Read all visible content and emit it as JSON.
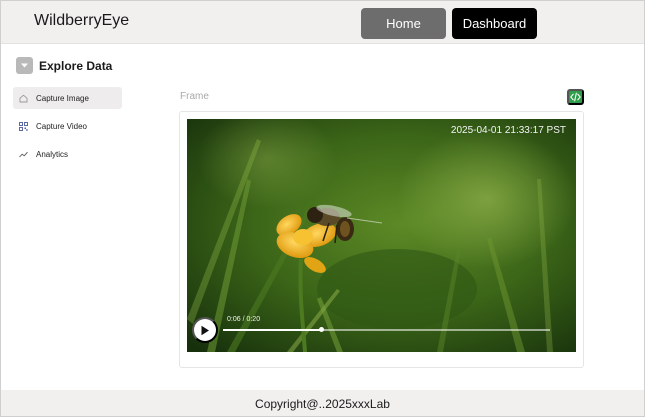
{
  "header": {
    "brand": "WildberryEye",
    "nav": {
      "home_label": "Home",
      "dashboard_label": "Dashboard"
    }
  },
  "sidebar": {
    "section_title": "Explore Data",
    "section_icon": "chevron-down-icon",
    "items": [
      {
        "label": "Capture Image",
        "icon": "camera-icon",
        "active": true
      },
      {
        "label": "Capture Video",
        "icon": "grid-icon",
        "active": false
      },
      {
        "label": "Analytics",
        "icon": "trend-line-icon",
        "active": false
      }
    ]
  },
  "main": {
    "frame_label": "Frame",
    "code_button_icon": "code-icon",
    "video": {
      "timestamp": "2025-04-01 21:33:17 PST",
      "time_display": "0:06 / 0:20",
      "progress_fraction": 0.3,
      "play_icon": "play-icon"
    }
  },
  "footer": {
    "copyright": "Copyright@..2025xxxLab"
  },
  "colors": {
    "header_bg": "#f2f0ef",
    "nav_home": "#6d6d6d",
    "nav_dashboard": "#000000",
    "code_button": "#2e9e4a",
    "active_item_bg": "#eeecec"
  }
}
